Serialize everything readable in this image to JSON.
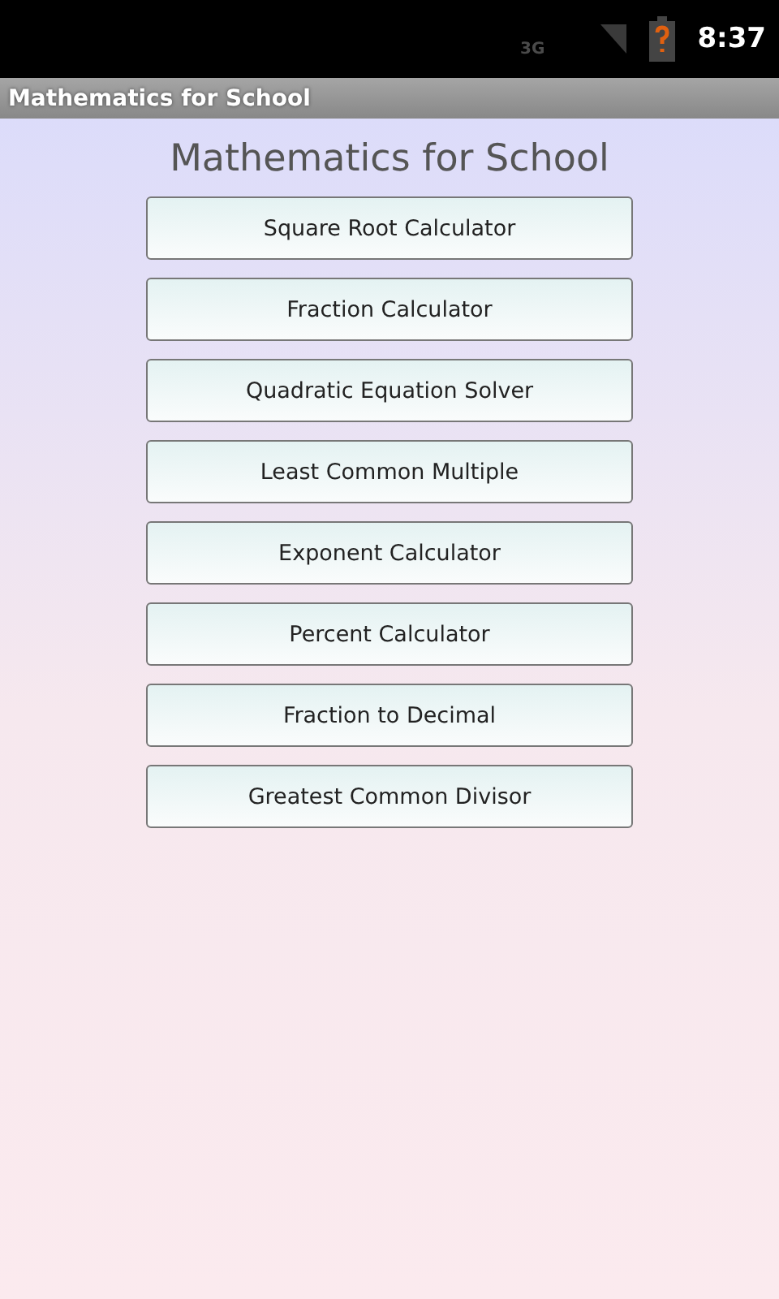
{
  "status_bar": {
    "network": "3G",
    "time": "8:37"
  },
  "app_bar": {
    "title": "Mathematics for School"
  },
  "heading": "Mathematics for School",
  "buttons": [
    "Square Root Calculator",
    "Fraction Calculator",
    "Quadratic Equation Solver",
    "Least Common Multiple",
    "Exponent Calculator",
    "Percent Calculator",
    "Fraction to Decimal",
    "Greatest Common Divisor"
  ]
}
